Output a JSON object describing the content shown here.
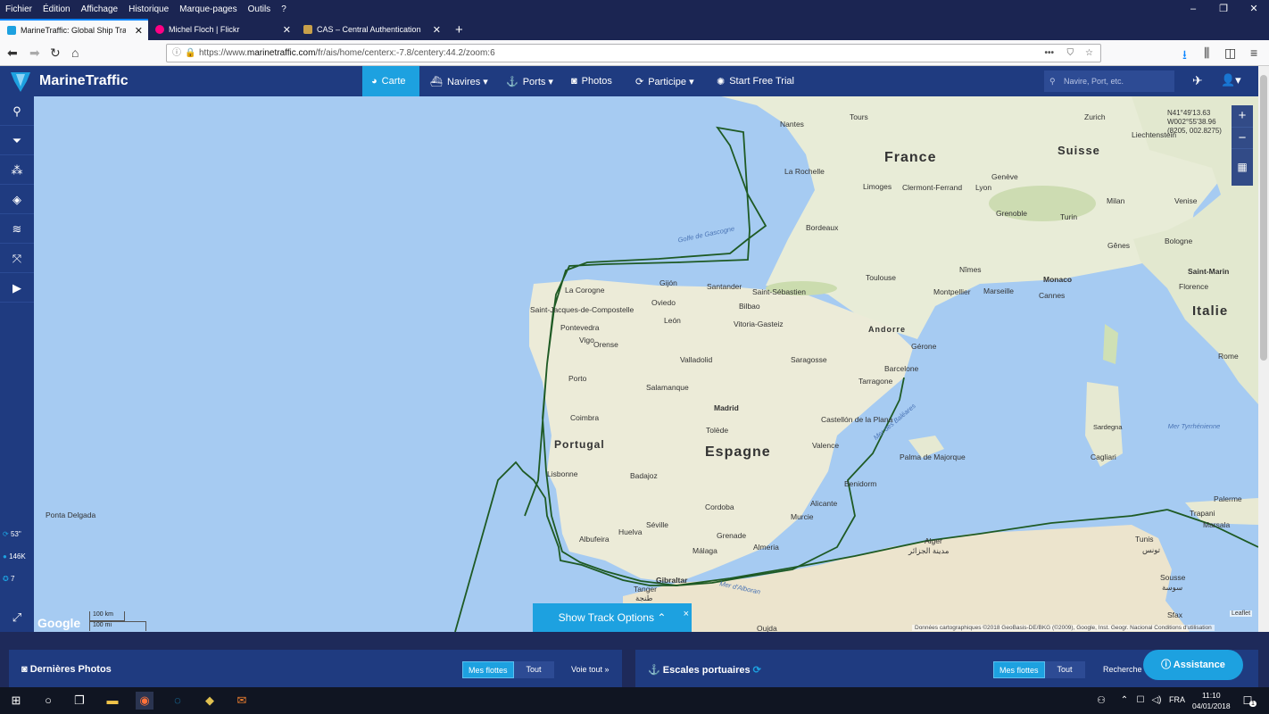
{
  "menubar": {
    "items": [
      "Fichier",
      "Édition",
      "Affichage",
      "Historique",
      "Marque-pages",
      "Outils",
      "?"
    ]
  },
  "tabs": [
    {
      "title": "MarineTraffic: Global Ship Track",
      "color": "#1da1e0",
      "active": true
    },
    {
      "title": "Michel Floch | Flickr",
      "color": "#ff0084",
      "active": false
    },
    {
      "title": "CAS – Central Authentication S",
      "color": "#c8a04a",
      "active": false
    }
  ],
  "new_tab": "+",
  "url": {
    "prefix": "https://www.",
    "domain": "marinetraffic.com",
    "path": "/fr/ais/home/centerx:-7.8/centery:44.2/zoom:6"
  },
  "header": {
    "brand": "MarineTraffic",
    "nav": [
      {
        "label": "Carte",
        "icon": "globe-icon",
        "active": true
      },
      {
        "label": "Navires ▾",
        "icon": "ship-icon"
      },
      {
        "label": "Ports ▾",
        "icon": "anchor-icon"
      },
      {
        "label": "Photos",
        "icon": "camera-icon"
      },
      {
        "label": "Participe ▾",
        "icon": "sync-icon"
      },
      {
        "label": "Start Free Trial",
        "icon": "bulb-icon"
      }
    ],
    "search_placeholder": "Navire, Port, etc."
  },
  "sidebar": {
    "icons": [
      "search-icon",
      "filter-icon",
      "fleet-icon",
      "layers-icon",
      "weather-icon",
      "measure-icon",
      "play-icon"
    ],
    "stats": [
      {
        "icon": "refresh-icon",
        "value": "53\""
      },
      {
        "icon": "info-icon",
        "value": "146K"
      },
      {
        "icon": "ship-count-icon",
        "value": "7"
      }
    ]
  },
  "map": {
    "coords": {
      "lat": "N41°49'13.63",
      "lon": "W002°55'38.96",
      "xy": "(8205, 002.8275)"
    },
    "countries": [
      "France",
      "Suisse",
      "Italie",
      "Portugal",
      "Espagne",
      "Andorre"
    ],
    "cities": [
      "Nantes",
      "Tours",
      "Zurich",
      "Liechtenstein",
      "La Rochelle",
      "Limoges",
      "Clermont-Ferrand",
      "Lyon",
      "Genève",
      "Milan",
      "Venise",
      "Bordeaux",
      "Grenoble",
      "Turin",
      "Gênes",
      "Bologne",
      "Florence",
      "Saint-Marin",
      "Toulouse",
      "Nîmes",
      "Montpellier",
      "Marseille",
      "Monaco",
      "Cannes",
      "Gijón",
      "Santander",
      "Saint-Sébastien",
      "La Corogne",
      "Oviedo",
      "Bilbao",
      "Saint-Jacques-de-Compostelle",
      "León",
      "Vitoria-Gasteiz",
      "Pontevedra",
      "Vigo",
      "Orense",
      "Valladolid",
      "Saragosse",
      "Gérone",
      "Barcelone",
      "Porto",
      "Salamanque",
      "Tarragone",
      "Rome",
      "Madrid",
      "Coimbra",
      "Tolède",
      "Castellón de la Plana",
      "Valence",
      "Lisbonne",
      "Badajoz",
      "Palma de Majorque",
      "Benidorm",
      "Cordoba",
      "Alicante",
      "Murcie",
      "Séville",
      "Huelva",
      "Albufeira",
      "Grenade",
      "Almeria",
      "Málaga",
      "Gibraltar",
      "Tanger",
      "طنجة",
      "Alger",
      "مدينة الجزائر",
      "Tunis",
      "تونس",
      "Sousse",
      "سوسة",
      "Sfax",
      "Palerme",
      "Trapani",
      "Marsala",
      "Oujda",
      "Ponta Delgada",
      "Sardegna",
      "Cagliari"
    ],
    "seas": [
      "Golfe de Gascogne",
      "Mer des Baléares",
      "Mer d'Alboran",
      "Mer Tyrrhénienne"
    ],
    "scale": [
      "100 km",
      "100 mi"
    ],
    "attribution": "Données cartographiques ©2018 GeoBasis-DE/BKG (©2009), Google, Inst. Geogr. Nacional   Conditions d'utilisation",
    "leaflet": "Leaflet",
    "google": "Google",
    "track_button": "Show Track Options",
    "track_close": "×"
  },
  "bottom": {
    "photos": {
      "title": "Dernières Photos",
      "seg": [
        "Mes flottes",
        "Tout"
      ],
      "link": "Voie tout »"
    },
    "ports": {
      "title": "Escales portuaires",
      "seg": [
        "Mes flottes",
        "Tout"
      ],
      "link": "Recherche"
    },
    "assist": "Assistance"
  },
  "taskbar": {
    "lang": "FRA",
    "time": "11:10",
    "date": "04/01/2018",
    "notif": "1"
  }
}
